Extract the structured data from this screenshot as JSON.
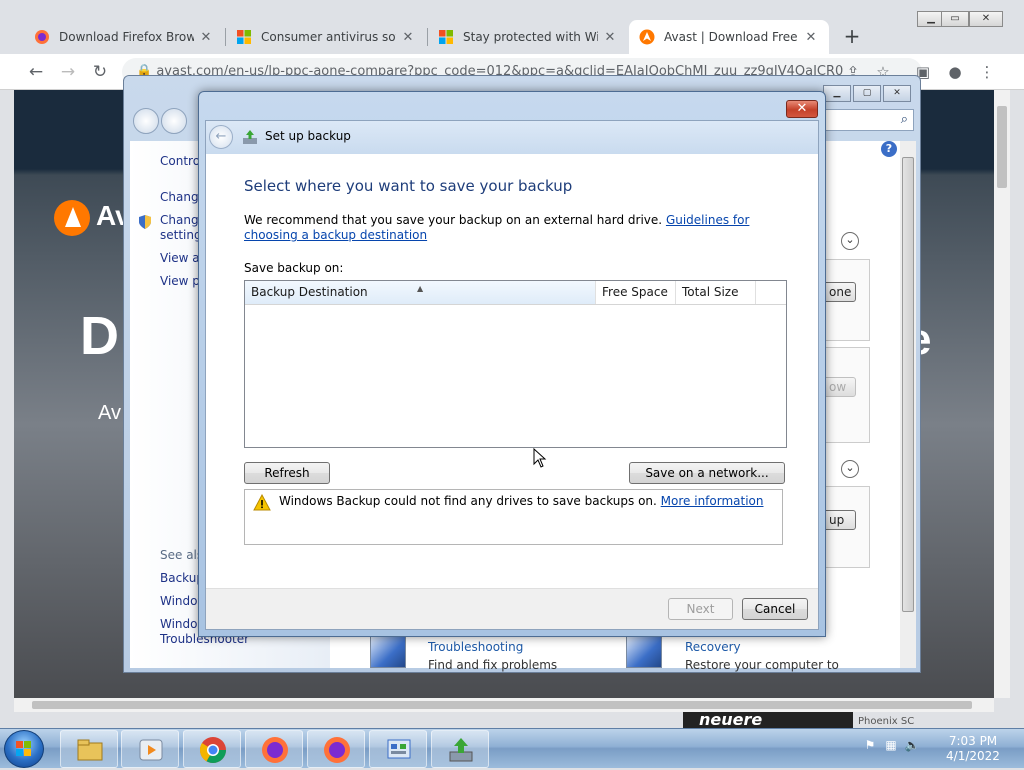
{
  "browser": {
    "tabs": [
      {
        "title": "Download Firefox Browser",
        "icon": "firefox-icon"
      },
      {
        "title": "Consumer antivirus software",
        "icon": "microsoft-icon"
      },
      {
        "title": "Stay protected with Windows",
        "icon": "microsoft-icon"
      },
      {
        "title": "Avast | Download Free Antivirus",
        "icon": "avast-icon"
      }
    ],
    "new_tab_label": "+",
    "address": "avast.com/en-us/lp-ppc-aone-compare?ppc_code=012&ppc=a&gclid=EAIaIQobChMI_zuu_zz9gIV4QaICR0"
  },
  "webpage": {
    "logo_text": "Av",
    "hero_title": "D",
    "hero_e": "e",
    "hero_sub": "Av",
    "bottom_text": "neuere",
    "bottom_small": "Phoenix SC"
  },
  "control_panel": {
    "nav_items": [
      "Contro",
      "Change",
      "Change settings",
      "View ar",
      "View pe"
    ],
    "see_also_label": "See also",
    "see_also_items": [
      "Backup",
      "Windov",
      "Windows Compatibility Troubleshooter"
    ],
    "side_buttons": [
      "one",
      "ow",
      "up"
    ],
    "tiles": [
      {
        "title": "Troubleshooting",
        "desc": "Find and fix problems"
      },
      {
        "title": "Recovery",
        "desc": "Restore your computer to"
      }
    ]
  },
  "dialog": {
    "title": "Set up backup",
    "heading": "Select where you want to save your backup",
    "recommend_text": "We recommend that you save your backup on an external hard drive.",
    "guidelines_link": "Guidelines for choosing a backup destination",
    "save_on_label": "Save backup on:",
    "columns": [
      "Backup Destination",
      "Free Space",
      "Total Size"
    ],
    "rows": [],
    "refresh_label": "Refresh",
    "network_label": "Save on a network...",
    "warning_text": "Windows Backup could not find any drives to save backups on.",
    "more_info_link": "More information",
    "next_label": "Next",
    "cancel_label": "Cancel"
  },
  "taskbar": {
    "apps": [
      "explorer-icon",
      "media-player-icon",
      "chrome-icon",
      "firefox-icon",
      "firefox-icon",
      "control-panel-icon",
      "backup-icon"
    ],
    "time": "7:03 PM",
    "date": "4/1/2022"
  }
}
